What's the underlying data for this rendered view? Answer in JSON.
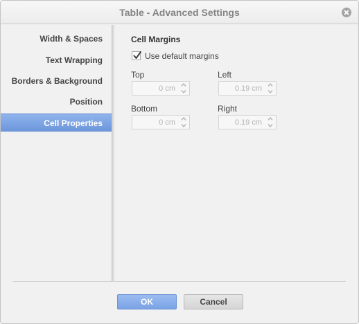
{
  "window": {
    "title": "Table - Advanced Settings"
  },
  "sidebar": {
    "items": [
      {
        "label": "Width & Spaces",
        "active": false
      },
      {
        "label": "Text Wrapping",
        "active": false
      },
      {
        "label": "Borders & Background",
        "active": false
      },
      {
        "label": "Position",
        "active": false
      },
      {
        "label": "Cell Properties",
        "active": true
      }
    ]
  },
  "cell_margins": {
    "title": "Cell Margins",
    "use_default": {
      "label": "Use default margins",
      "checked": true
    },
    "top": {
      "label": "Top",
      "value": "0 cm"
    },
    "left": {
      "label": "Left",
      "value": "0.19 cm"
    },
    "bottom": {
      "label": "Bottom",
      "value": "0 cm"
    },
    "right": {
      "label": "Right",
      "value": "0.19 cm"
    }
  },
  "footer": {
    "ok_label": "OK",
    "cancel_label": "Cancel"
  },
  "colors": {
    "accent": "#7aa3e4",
    "active_item": "#6d97dc"
  },
  "icons": {
    "close": "close-icon",
    "check": "checkmark-icon",
    "spin_up": "chevron-up-icon",
    "spin_down": "chevron-down-icon"
  }
}
